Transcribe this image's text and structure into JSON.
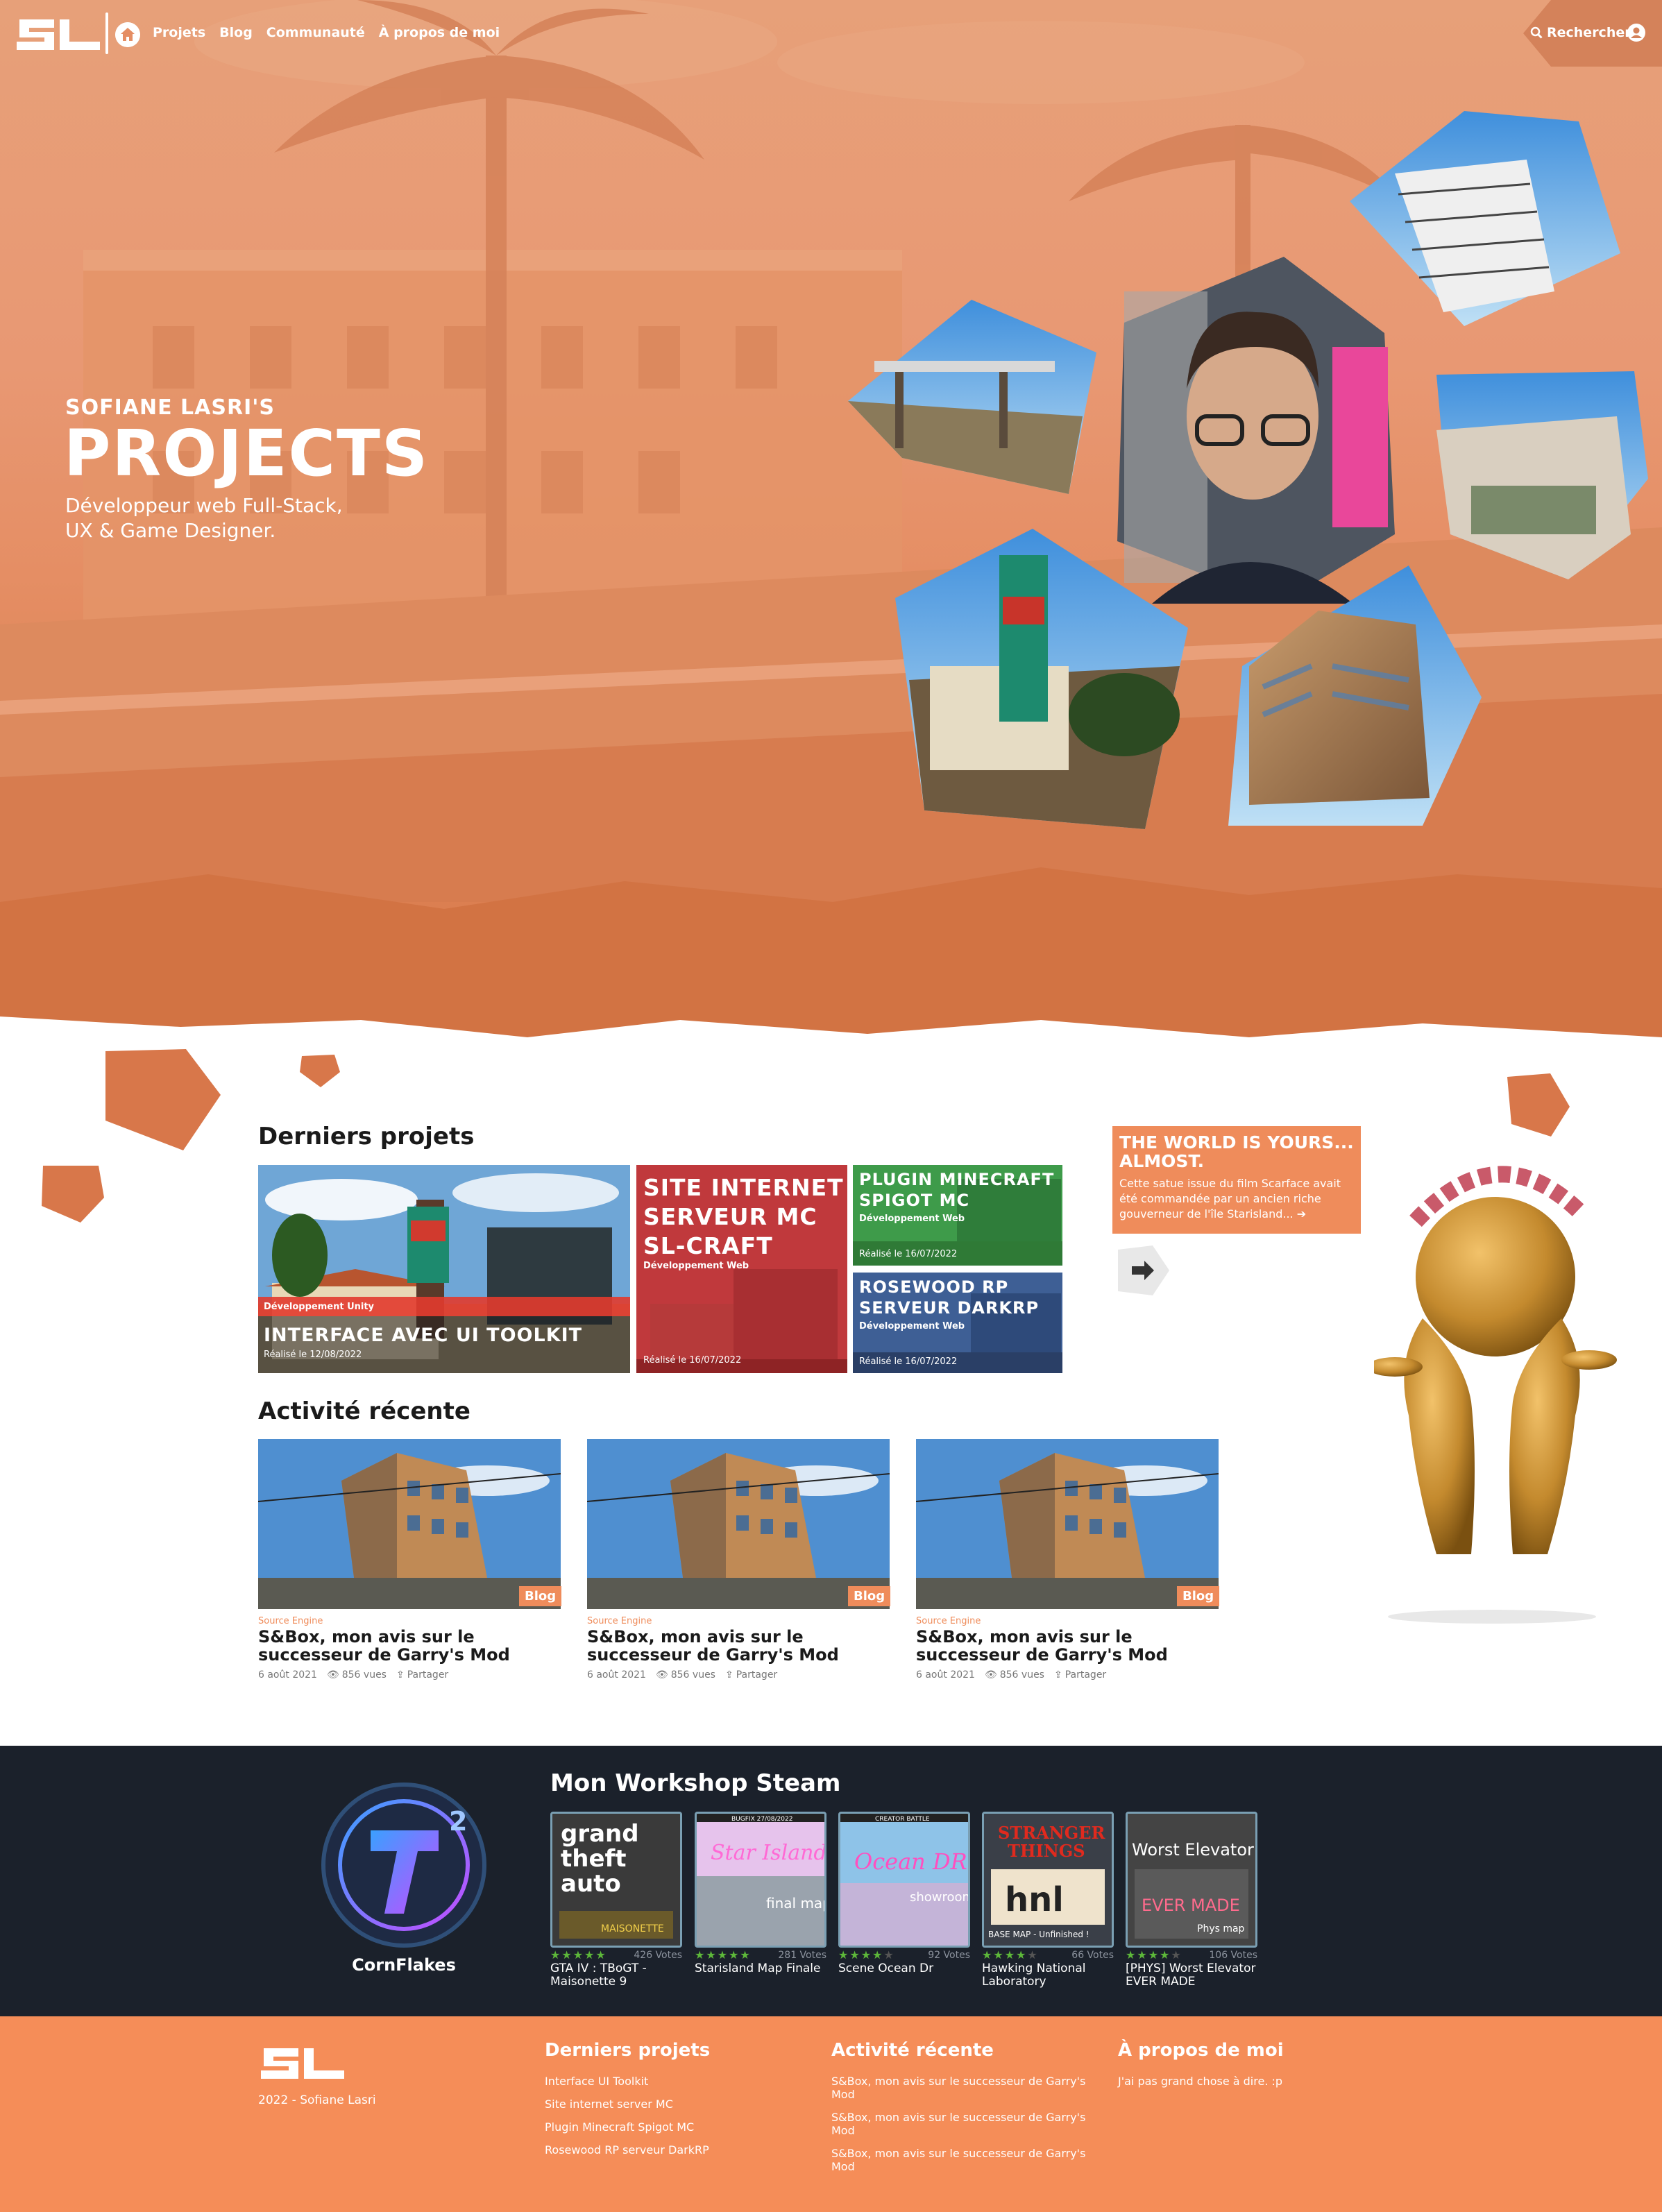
{
  "header": {
    "logo": "SL",
    "nav": [
      "Projets",
      "Blog",
      "Communauté",
      "À propos de moi"
    ],
    "search_label": "Rechercher"
  },
  "hero": {
    "pretitle": "SOFIANE LASRI'S",
    "title": "PROJECTS",
    "subtitle_line1": "Développeur web Full-Stack,",
    "subtitle_line2": "UX & Game Designer."
  },
  "latest_projects": {
    "title": "Derniers projets",
    "items": [
      {
        "category": "Développement Unity",
        "title": "INTERFACE AVEC UI TOOLKIT",
        "date": "Réalisé le 12/08/2022"
      },
      {
        "category": "Développement Web",
        "title_line1": "SITE INTERNET",
        "title_line2": "SERVEUR MC",
        "title_line3": "SL-CRAFT",
        "date": "Réalisé le 16/07/2022"
      },
      {
        "category": "Développement Web",
        "title_line1": "PLUGIN MINECRAFT",
        "title_line2": "SPIGOT MC",
        "date": "Réalisé le 16/07/2022"
      },
      {
        "category": "Développement Web",
        "title_line1": "ROSEWOOD RP",
        "title_line2": "SERVEUR DARKRP",
        "date": "Réalisé le 16/07/2022"
      }
    ]
  },
  "promo": {
    "title": "THE WORLD IS YOURS... ALMOST.",
    "text": "Cette satue issue du film Scarface avait été commandée par un ancien riche gouverneur de l'île Starisland... ➔"
  },
  "activity": {
    "title": "Activité récente",
    "items": [
      {
        "badge": "Blog",
        "category": "Source Engine",
        "title": "S&Box, mon avis sur le successeur de Garry's Mod",
        "date": "6 août 2021",
        "views": "856 vues",
        "share": "Partager"
      },
      {
        "badge": "Blog",
        "category": "Source Engine",
        "title": "S&Box, mon avis sur le successeur de Garry's Mod",
        "date": "6 août 2021",
        "views": "856 vues",
        "share": "Partager"
      },
      {
        "badge": "Blog",
        "category": "Source Engine",
        "title": "S&Box, mon avis sur le successeur de Garry's Mod",
        "date": "6 août 2021",
        "views": "856 vues",
        "share": "Partager"
      }
    ]
  },
  "workshop": {
    "title": "Mon Workshop Steam",
    "profile_name": "CornFlakes",
    "items": [
      {
        "title": "GTA IV : TBoGT - Maisonette 9",
        "votes": "426 Votes",
        "rating": 5,
        "thumb_text": "grand theft auto",
        "thumb_sub": "MAISONETTE"
      },
      {
        "title": "Starisland Map Finale",
        "votes": "281 Votes",
        "rating": 5,
        "thumb_text": "Star Island",
        "thumb_sub": "final map",
        "banner": "BUGFIX 27/08/2022"
      },
      {
        "title": "Scene Ocean Dr",
        "votes": "92 Votes",
        "rating": 4,
        "thumb_text": "Ocean DR",
        "thumb_sub": "showroom",
        "banner": "CREATOR BATTLE"
      },
      {
        "title": "Hawking National Laboratory",
        "votes": "66 Votes",
        "rating": 4,
        "thumb_text": "STRANGER THINGS",
        "thumb_sub": "BASE MAP - Unfinished !"
      },
      {
        "title": "[PHYS] Worst Elevator EVER MADE",
        "votes": "106 Votes",
        "rating": 4,
        "thumb_text": "Worst Elevator",
        "thumb_sub": "EVER MADE"
      }
    ]
  },
  "footer": {
    "copyright": "2022 - Sofiane Lasri",
    "projects_title": "Derniers projets",
    "projects_links": [
      "Interface UI Toolkit",
      "Site internet server MC",
      "Plugin Minecraft Spigot MC",
      "Rosewood RP serveur DarkRP"
    ],
    "activity_title": "Activité récente",
    "activity_links": [
      "S&Box, mon avis sur le successeur de Garry's Mod",
      "S&Box, mon avis sur le successeur de Garry's Mod",
      "S&Box, mon avis sur le successeur de Garry's Mod"
    ],
    "about_title": "À propos de moi",
    "about_text": "J'ai pas grand chose à dire. :p"
  },
  "colors": {
    "accent": "#ef8c5b",
    "hero_orange": "#e58e64",
    "dark_bg": "#1b212b",
    "footer_bg": "#f58d58",
    "star_green": "#5db83a"
  }
}
